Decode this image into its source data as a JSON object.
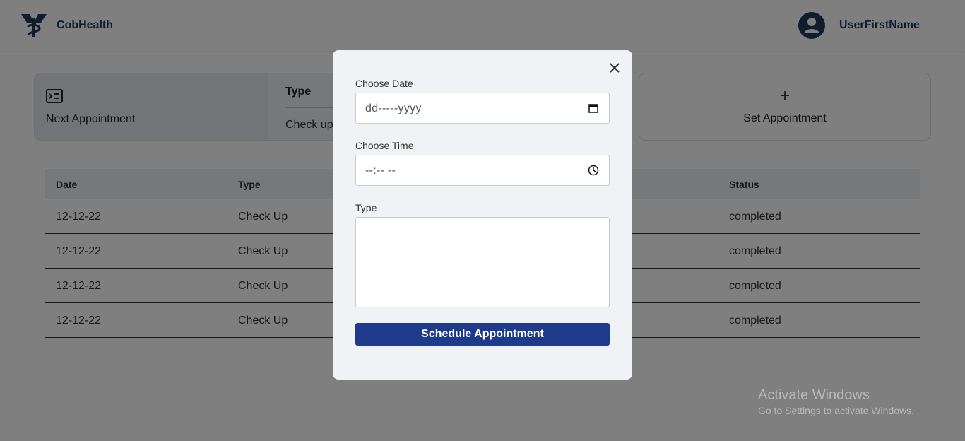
{
  "header": {
    "brand": "CobHealth",
    "username": "UserFirstName",
    "logo_icon": "caduceus-logo-icon",
    "avatar_icon": "user-avatar-icon"
  },
  "cards": {
    "next_appointment_label": "Next Appointment",
    "type_header": "Type",
    "type_value": "Check up",
    "set_appointment_label": "Set Appointment",
    "plus_symbol": "+"
  },
  "table": {
    "headers": [
      "Date",
      "Type",
      "Status"
    ],
    "rows": [
      {
        "date": "12-12-22",
        "type": "Check Up",
        "status": "completed"
      },
      {
        "date": "12-12-22",
        "type": "Check Up",
        "status": "completed"
      },
      {
        "date": "12-12-22",
        "type": "Check Up",
        "status": "completed"
      },
      {
        "date": "12-12-22",
        "type": "Check Up",
        "status": "completed"
      }
    ]
  },
  "modal": {
    "date_label": "Choose Date",
    "date_placeholder": "dd-----yyyy",
    "time_label": "Choose Time",
    "time_placeholder": "--:-- --",
    "type_label": "Type",
    "type_value": "",
    "submit_label": "Schedule Appointment"
  },
  "watermark": {
    "title": "Activate Windows",
    "subtitle": "Go to Settings to activate Windows."
  },
  "colors": {
    "brand": "#1e3a5f",
    "button": "#1e3a8a",
    "overlay": "rgba(0,0,0,0.5)"
  }
}
